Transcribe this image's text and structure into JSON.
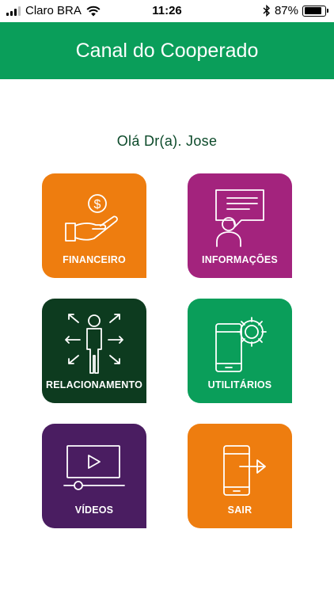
{
  "status_bar": {
    "carrier": "Claro BRA",
    "time": "11:26",
    "battery_percent": "87%",
    "battery_level": 0.87
  },
  "header": {
    "title": "Canal do Cooperado"
  },
  "greeting": "Olá Dr(a). Jose",
  "tiles": [
    {
      "label": "FINANCEIRO",
      "icon": "hand-coin-icon",
      "color": "#ee7d0f"
    },
    {
      "label": "INFORMAÇÕES",
      "icon": "chat-person-icon",
      "color": "#a3237d"
    },
    {
      "label": "RELACIONAMENTO",
      "icon": "person-arrows-icon",
      "color": "#0d3b1f"
    },
    {
      "label": "UTILITÁRIOS",
      "icon": "phone-gear-icon",
      "color": "#0a9e5a"
    },
    {
      "label": "VÍDEOS",
      "icon": "video-player-icon",
      "color": "#4a1d61"
    },
    {
      "label": "SAIR",
      "icon": "phone-exit-icon",
      "color": "#ee7d0f"
    }
  ],
  "colors": {
    "header_green": "#0a9e5a",
    "greeting_text": "#0c4a2a"
  }
}
